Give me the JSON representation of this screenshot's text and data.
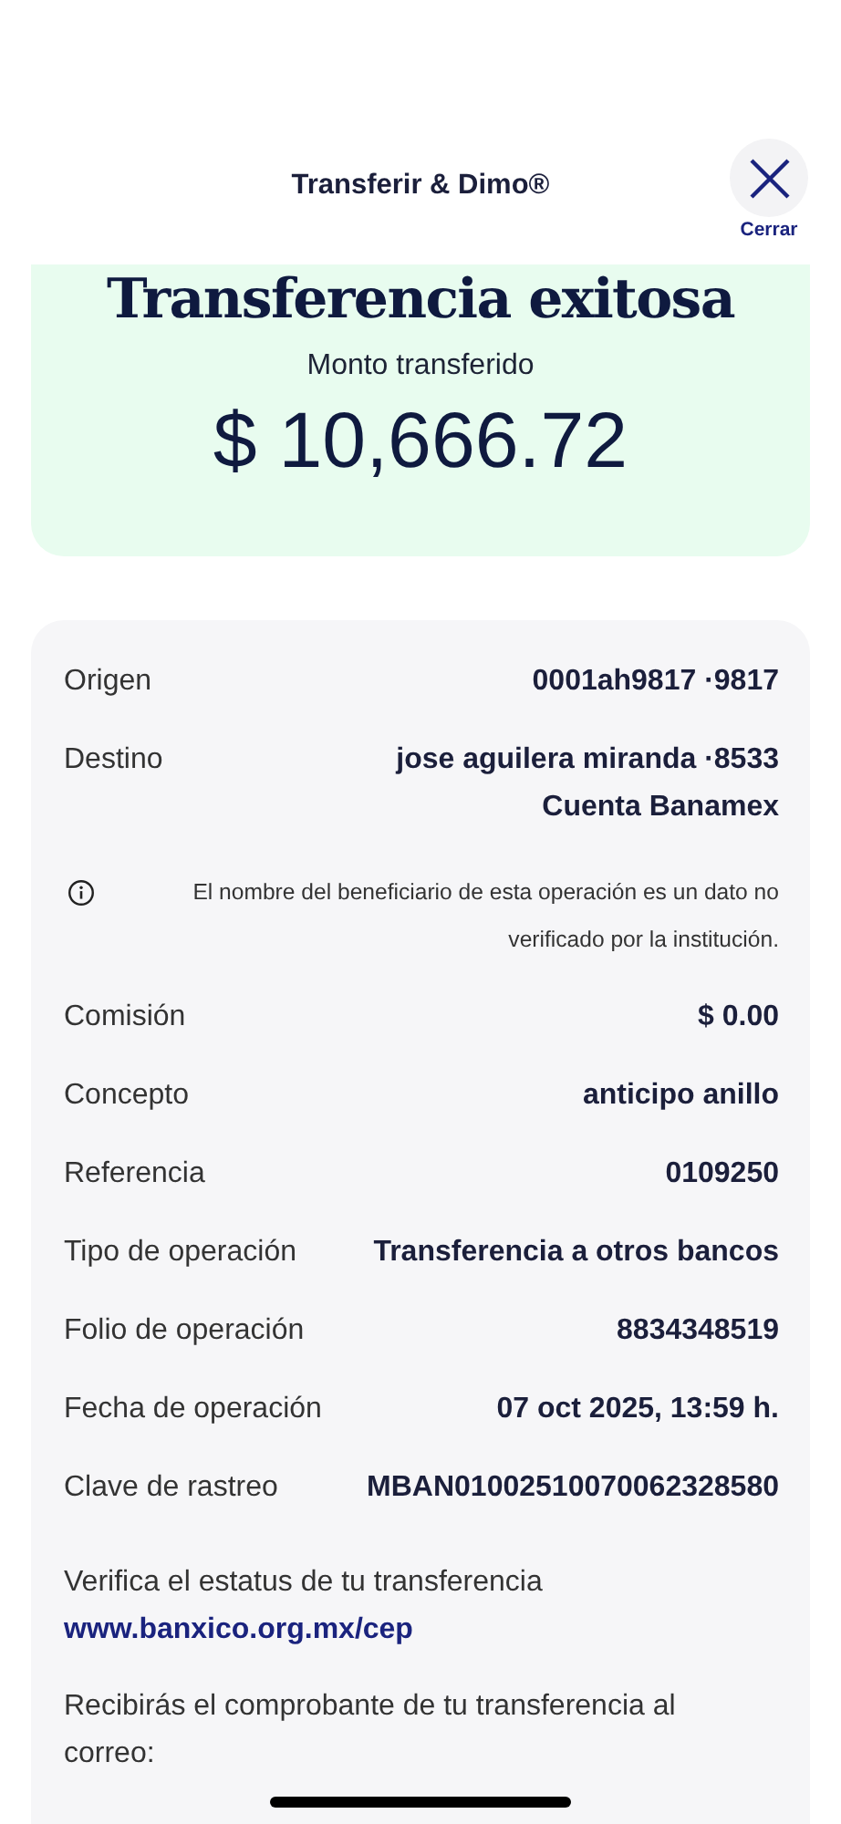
{
  "header": {
    "title": "Transferir & Dimo®",
    "close_label": "Cerrar"
  },
  "summary": {
    "title": "Transferencia exitosa",
    "subtitle": "Monto transferido",
    "amount": "$ 10,666.72"
  },
  "details": [
    {
      "kind": "row",
      "label": "Origen",
      "value": [
        "0001ah9817 ·9817"
      ]
    },
    {
      "kind": "row",
      "label": "Destino",
      "value": [
        "jose aguilera miranda ·8533",
        "Cuenta Banamex"
      ]
    },
    {
      "kind": "note",
      "text": "El nombre del beneficiario de esta operación es un dato no verificado por la institución."
    },
    {
      "kind": "row",
      "label": "Comisión",
      "value": [
        "$ 0.00"
      ]
    },
    {
      "kind": "row",
      "label": "Concepto",
      "value": [
        "anticipo anillo"
      ]
    },
    {
      "kind": "row",
      "label": "Referencia",
      "value": [
        "0109250"
      ]
    },
    {
      "kind": "row",
      "label": "Tipo de operación",
      "value": [
        "Transferencia a otros bancos"
      ]
    },
    {
      "kind": "row",
      "label": "Folio de operación",
      "value": [
        "8834348519"
      ]
    },
    {
      "kind": "row",
      "label": "Fecha de operación",
      "value": [
        "07 oct 2025, 13:59 h."
      ]
    },
    {
      "kind": "row",
      "label": "Clave de rastreo",
      "value": [
        "MBAN01002510070062328580"
      ]
    },
    {
      "kind": "link",
      "text": "Verifica el estatus de tu transferencia",
      "url": "www.banxico.org.mx/cep"
    },
    {
      "kind": "text",
      "text": "Recibirás el comprobante de tu transferencia al correo:"
    }
  ]
}
